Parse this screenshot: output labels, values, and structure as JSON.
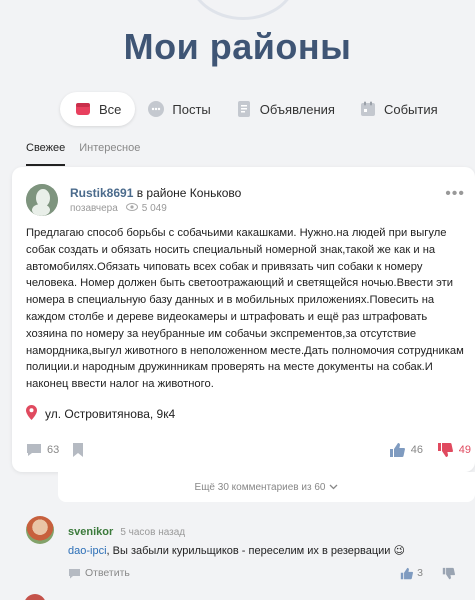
{
  "page": {
    "title": "Мои районы"
  },
  "tabs": [
    {
      "label": "Все",
      "icon": "all-icon"
    },
    {
      "label": "Посты",
      "icon": "posts-icon"
    },
    {
      "label": "Объявления",
      "icon": "ads-icon"
    },
    {
      "label": "События",
      "icon": "events-icon"
    }
  ],
  "subtabs": [
    {
      "label": "Свежее",
      "active": true
    },
    {
      "label": "Интересное",
      "active": false
    }
  ],
  "post": {
    "author": "Rustik8691",
    "district_text": "в районе Коньково",
    "time": "позавчера",
    "views": "5 049",
    "text": "Предлагаю способ борьбы с собачьими какашками. Нужно.на людей при выгуле собак создать и обязать носить специальный номерной знак,такой же как и на автомобилях.Обязать чиповать всех собак и привязать чип собаки к номеру человека. Номер должен быть светоотражающий и светящейся ночью.Ввести эти номера в специальную базу данных и в мобильных приложениях.Повесить на каждом столбе и дереве видеокамеры и штрафовать и ещё раз штрафовать хозяина по номеру за неубранные им собачьи экспрементов,за отсутствие намордника,выгул животного в неположенном месте.Дать полномочия сотрудникам полиции.и народным дружинникам проверять на месте документы на собак.И наконец ввести налог на животного.",
    "address": "ул. Островитянова, 9к4",
    "comments_count": "63",
    "likes": "46",
    "dislikes": "49"
  },
  "more_comments": "Ещё 30 комментариев из 60",
  "comment": {
    "author": "svenikor",
    "time": "5 часов назад",
    "reply_to": "dao-ipci",
    "text": ", Вы забыли курильщиков - переселим их в резервации 😉",
    "reply_label": "Ответить",
    "likes": "3"
  },
  "colors": {
    "title": "#3f5575",
    "accent_red": "#e04a5f",
    "link_blue": "#2c6fb7",
    "author_green": "#3b7a3b"
  }
}
